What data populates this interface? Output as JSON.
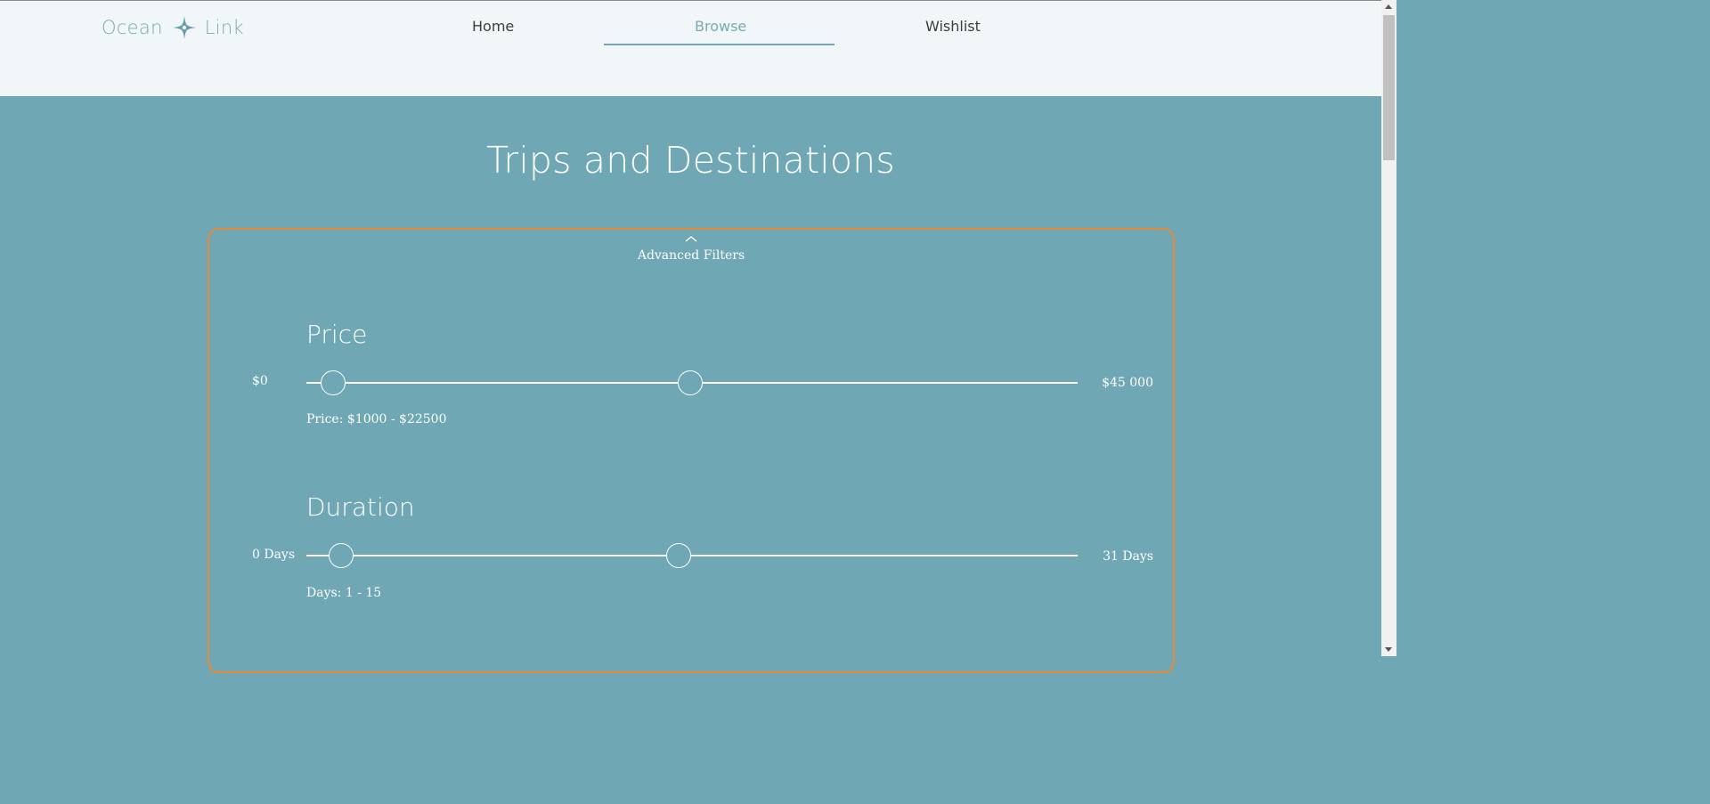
{
  "header": {
    "logo_left": "Ocean",
    "logo_right": "Link",
    "logo_icon": "compass-rose-icon",
    "nav": [
      {
        "label": "Home",
        "active": false
      },
      {
        "label": "Browse",
        "active": true
      },
      {
        "label": "Wishlist",
        "active": false
      }
    ]
  },
  "page": {
    "title": "Trips and Destinations"
  },
  "filters": {
    "toggle_label": "Advanced Filters",
    "toggle_icon": "chevron-up-icon",
    "price": {
      "title": "Price",
      "min_label": "$0",
      "max_label": "$45 000",
      "summary": "Price: $1000 - $22500",
      "range": [
        0,
        45000
      ],
      "selected": [
        1000,
        22500
      ]
    },
    "duration": {
      "title": "Duration",
      "min_label": "0 Days",
      "max_label": "31 Days",
      "summary": "Days: 1 - 15",
      "range": [
        0,
        31
      ],
      "selected": [
        1,
        15
      ]
    }
  },
  "colors": {
    "background": "#6fa8b4",
    "header_bg": "#f1f7f8",
    "accent": "#7aa9b5",
    "filter_border": "#e58a36",
    "text_light": "#ffffff"
  }
}
